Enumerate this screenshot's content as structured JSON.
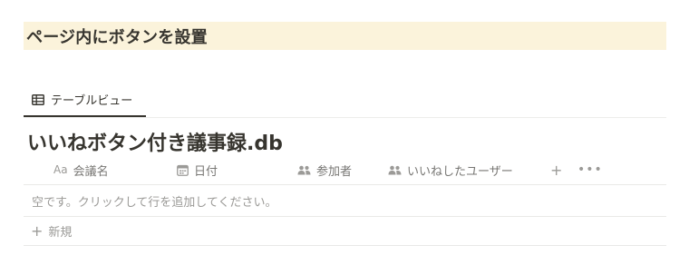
{
  "heading": {
    "text": "ページ内にボタンを設置"
  },
  "view_tabs": [
    {
      "label": "テーブルビュー",
      "icon": "table-icon"
    }
  ],
  "database": {
    "title": "いいねボタン付き議事録.db",
    "columns": [
      {
        "label": "会議名",
        "icon": "text-property-icon",
        "icon_text": "Aa"
      },
      {
        "label": "日付",
        "icon": "calendar-icon"
      },
      {
        "label": "参加者",
        "icon": "people-icon"
      },
      {
        "label": "いいねしたユーザー",
        "icon": "people-icon"
      }
    ],
    "add_column_icon": "+",
    "more_icon": "•••",
    "empty_message": "空です。クリックして行を追加してください。",
    "new_row_label": "新規",
    "new_row_icon": "+"
  },
  "colors": {
    "heading_background": "#fbf3db",
    "text_primary": "#37352f",
    "text_secondary": "#787774",
    "text_muted": "#9b9a97",
    "divider": "#e9e9e7"
  }
}
